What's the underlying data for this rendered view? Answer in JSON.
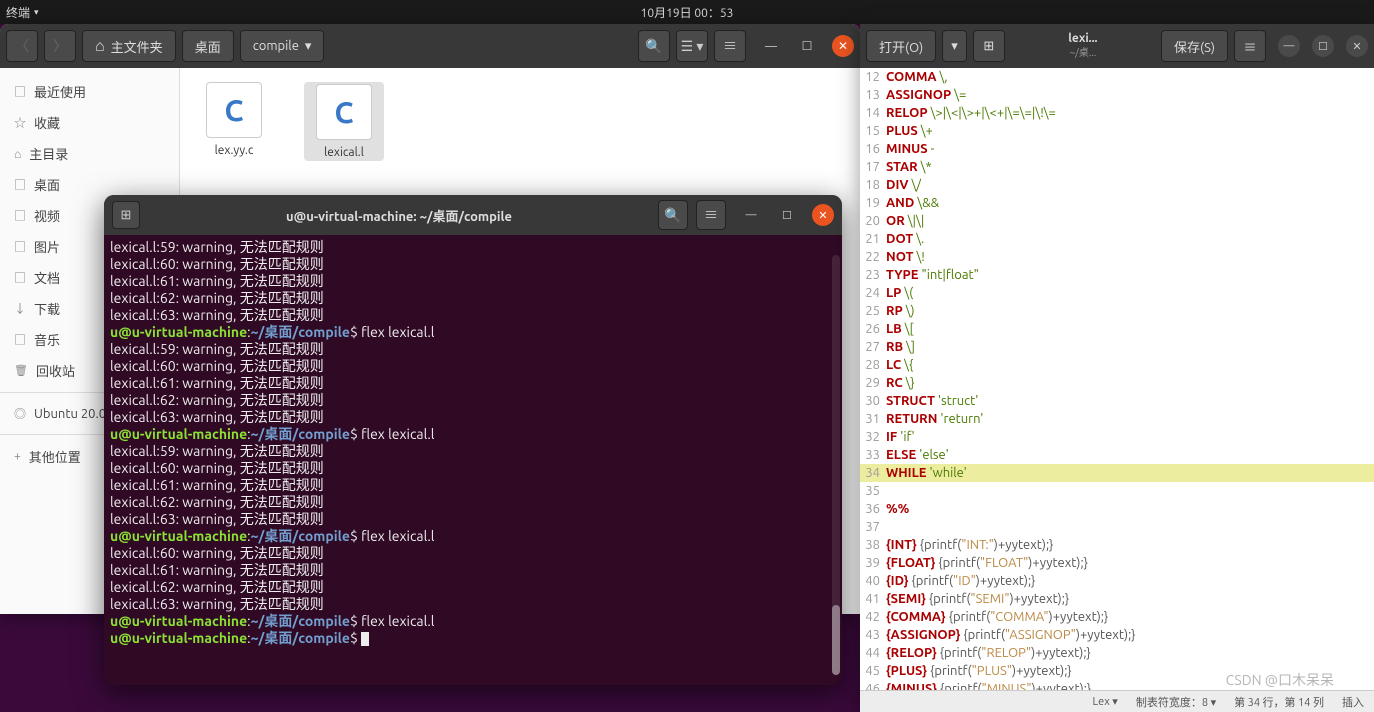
{
  "panel": {
    "app": "终端",
    "clock": "10月19日 00：53"
  },
  "fm": {
    "path": {
      "home": "主文件夹",
      "seg1": "桌面",
      "seg2": "compile"
    },
    "sidebar": {
      "recent": "最近使用",
      "starred": "收藏",
      "home": "主目录",
      "desktop": "桌面",
      "videos": "视频",
      "pictures": "图片",
      "documents": "文档",
      "downloads": "下载",
      "music": "音乐",
      "trash": "回收站",
      "disk": "Ubuntu 20.0..",
      "other": "其他位置"
    },
    "files": {
      "f1": "lex.yy.c",
      "f2": "lexical.l"
    }
  },
  "term": {
    "title": "u@u-virtual-machine: ~/桌面/compile",
    "user": "u@u-virtual-machine",
    "path": "~/桌面/compile",
    "cmd": "flex lexical.l",
    "warn59": "lexical.l:59: warning, 无法匹配规则",
    "warn60": "lexical.l:60: warning, 无法匹配规则",
    "warn61": "lexical.l:61: warning, 无法匹配规则",
    "warn62": "lexical.l:62: warning, 无法匹配规则",
    "warn63": "lexical.l:63: warning, 无法匹配规则"
  },
  "ged": {
    "open": "打开(O)",
    "save": "保存(S)",
    "title": "lexi...",
    "subtitle": "~/桌...",
    "status": {
      "lang": "Lex",
      "tab": "制表符宽度：8",
      "pos": "第 34 行，第 14 列",
      "mode": "插入"
    },
    "lines": [
      {
        "n": 12,
        "kw": "COMMA",
        "re": "\\,"
      },
      {
        "n": 13,
        "kw": "ASSIGNOP",
        "re": "\\="
      },
      {
        "n": 14,
        "kw": "RELOP",
        "re": "\\>|\\<|\\>+|\\<+|\\=\\=|\\!\\="
      },
      {
        "n": 15,
        "kw": "PLUS",
        "re": "\\+"
      },
      {
        "n": 16,
        "kw": "MINUS",
        "re": "-"
      },
      {
        "n": 17,
        "kw": "STAR",
        "re": "\\*"
      },
      {
        "n": 18,
        "kw": "DIV",
        "re": "\\/"
      },
      {
        "n": 19,
        "kw": "AND",
        "re": "\\&&"
      },
      {
        "n": 20,
        "kw": "OR",
        "re": "\\|\\|"
      },
      {
        "n": 21,
        "kw": "DOT",
        "re": "\\."
      },
      {
        "n": 22,
        "kw": "NOT",
        "re": "\\!"
      },
      {
        "n": 23,
        "kw": "TYPE",
        "re": "\"int|float\""
      },
      {
        "n": 24,
        "kw": "LP",
        "re": "\\("
      },
      {
        "n": 25,
        "kw": "RP",
        "re": "\\)"
      },
      {
        "n": 26,
        "kw": "LB",
        "re": "\\["
      },
      {
        "n": 27,
        "kw": "RB",
        "re": "\\]"
      },
      {
        "n": 28,
        "kw": "LC",
        "re": "\\{"
      },
      {
        "n": 29,
        "kw": "RC",
        "re": "\\}"
      },
      {
        "n": 30,
        "kw": "STRUCT",
        "re": "'struct'"
      },
      {
        "n": 31,
        "kw": "RETURN",
        "re": "'return'"
      },
      {
        "n": 32,
        "kw": "IF",
        "re": "'if'"
      },
      {
        "n": 33,
        "kw": "ELSE",
        "re": "'else'"
      },
      {
        "n": 34,
        "kw": "WHILE",
        "re": "'while'",
        "hl": true
      },
      {
        "n": 35,
        "raw": ""
      },
      {
        "n": 36,
        "pct": "%%"
      },
      {
        "n": 37,
        "raw": ""
      },
      {
        "n": 38,
        "rule": "INT",
        "str": "INT:"
      },
      {
        "n": 39,
        "rule": "FLOAT",
        "str": "FLOAT"
      },
      {
        "n": 40,
        "rule": "ID",
        "str": "ID"
      },
      {
        "n": 41,
        "rule": "SEMI",
        "str": "SEMI"
      },
      {
        "n": 42,
        "rule": "COMMA",
        "str": "COMMA"
      },
      {
        "n": 43,
        "rule": "ASSIGNOP",
        "str": "ASSIGNOP"
      },
      {
        "n": 44,
        "rule": "RELOP",
        "str": "RELOP"
      },
      {
        "n": 45,
        "rule": "PLUS",
        "str": "PLUS"
      },
      {
        "n": 46,
        "rule": "MINUS",
        "str": "MINUS"
      }
    ]
  },
  "watermark": "CSDN @口木呆呆"
}
